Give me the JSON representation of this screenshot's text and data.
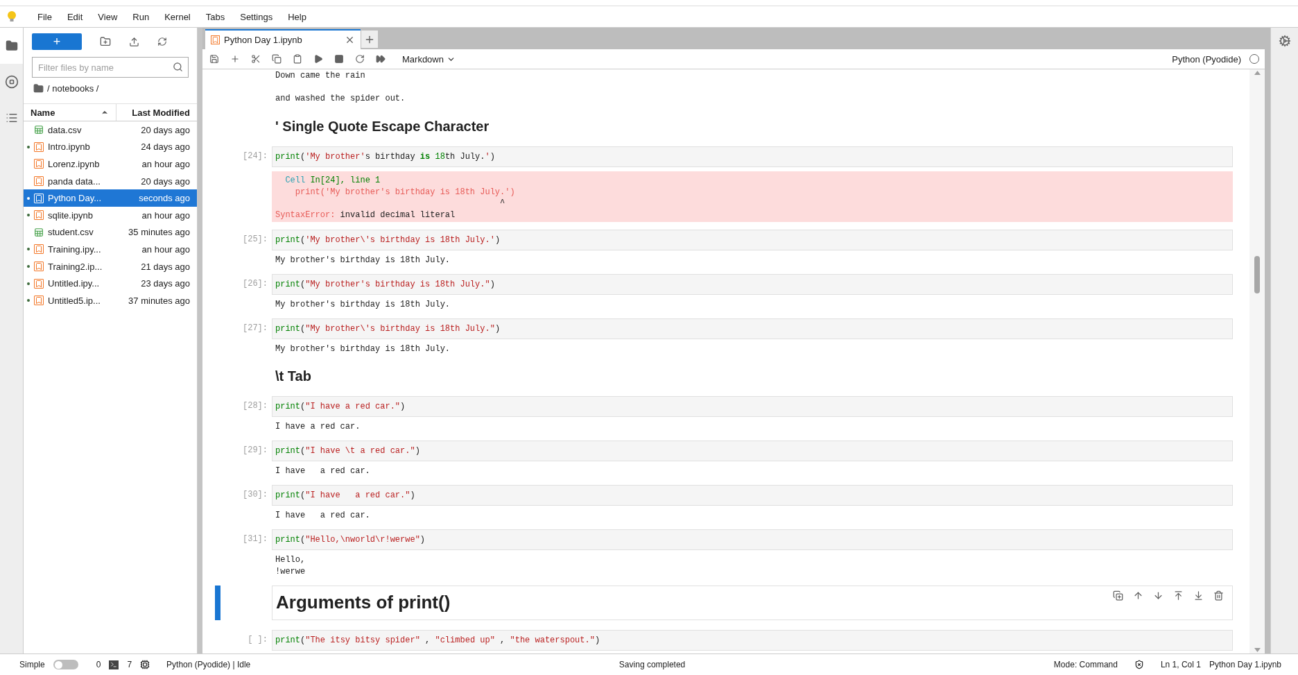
{
  "menu": [
    "File",
    "Edit",
    "View",
    "Run",
    "Kernel",
    "Tabs",
    "Settings",
    "Help"
  ],
  "left_rail": [
    {
      "kind": "folder",
      "selected": true
    },
    {
      "kind": "running",
      "selected": false
    },
    {
      "kind": "toc",
      "selected": false
    }
  ],
  "file_browser": {
    "new_button": "+",
    "filter": {
      "placeholder": "Filter files by name"
    },
    "path": "/ notebooks /",
    "columns": [
      {
        "label": "Name",
        "sorted": true
      },
      {
        "label": "Last Modified",
        "sorted": false
      }
    ],
    "files": [
      {
        "kind": "csv",
        "name": "data.csv",
        "modified": "20 days ago",
        "running": false,
        "selected": false
      },
      {
        "kind": "notebook",
        "name": "Intro.ipynb",
        "modified": "24 days ago",
        "running": true,
        "selected": false
      },
      {
        "kind": "notebook",
        "name": "Lorenz.ipynb",
        "modified": "an hour ago",
        "running": false,
        "selected": false
      },
      {
        "kind": "notebook",
        "name": "panda data...",
        "modified": "20 days ago",
        "running": false,
        "selected": false
      },
      {
        "kind": "notebook",
        "name": "Python Day...",
        "modified": "seconds ago",
        "running": true,
        "selected": true
      },
      {
        "kind": "notebook",
        "name": "sqlite.ipynb",
        "modified": "an hour ago",
        "running": true,
        "selected": false
      },
      {
        "kind": "csv",
        "name": "student.csv",
        "modified": "35 minutes ago",
        "running": false,
        "selected": false
      },
      {
        "kind": "notebook",
        "name": "Training.ipy...",
        "modified": "an hour ago",
        "running": true,
        "selected": false
      },
      {
        "kind": "notebook",
        "name": "Training2.ip...",
        "modified": "21 days ago",
        "running": true,
        "selected": false
      },
      {
        "kind": "notebook",
        "name": "Untitled.ipy...",
        "modified": "23 days ago",
        "running": true,
        "selected": false
      },
      {
        "kind": "notebook",
        "name": "Untitled5.ip...",
        "modified": "37 minutes ago",
        "running": true,
        "selected": false
      }
    ]
  },
  "tabs": [
    {
      "label": "Python Day 1.ipynb",
      "selected": true
    }
  ],
  "toolbar": {
    "cell_type": "Markdown",
    "kernel": "Python (Pyodide)",
    "kernel_busy": false
  },
  "cells": [
    {
      "kind": "text",
      "lines": [
        "Down came the rain",
        "and washed the spider out."
      ]
    },
    {
      "kind": "heading",
      "text": "' Single Quote Escape Character"
    },
    {
      "kind": "code",
      "prompt": "[24]:",
      "code": [
        {
          "kind": "builtin",
          "text": "print"
        },
        {
          "kind": "plain",
          "text": "("
        },
        {
          "kind": "string",
          "text": "'My brother'"
        },
        {
          "kind": "plain",
          "text": "s birthday "
        },
        {
          "kind": "keyword",
          "text": "is"
        },
        {
          "kind": "number",
          "text": " 18"
        },
        {
          "kind": "plain",
          "text": "th July."
        },
        {
          "kind": "string",
          "text": "'"
        },
        {
          "kind": "plain",
          "text": ")"
        }
      ],
      "error": [
        [
          {
            "kind": "cyan",
            "text": "  Cell"
          },
          {
            "kind": "green",
            "text": " In[24], line 1"
          }
        ],
        [
          {
            "kind": "red",
            "text": "    print('My brother's birthday is 18th July.')"
          }
        ],
        [
          {
            "kind": "plain",
            "text": "                                             ^"
          }
        ],
        [
          {
            "kind": "red",
            "text": "SyntaxError:"
          },
          {
            "kind": "plain",
            "text": " invalid decimal literal"
          }
        ]
      ]
    },
    {
      "kind": "code",
      "prompt": "[25]:",
      "code": [
        {
          "kind": "builtin",
          "text": "print"
        },
        {
          "kind": "plain",
          "text": "("
        },
        {
          "kind": "string",
          "text": "'My brother\\'s birthday is 18th July.'"
        },
        {
          "kind": "plain",
          "text": ")"
        }
      ],
      "output": [
        "My brother's birthday is 18th July."
      ]
    },
    {
      "kind": "code",
      "prompt": "[26]:",
      "code": [
        {
          "kind": "builtin",
          "text": "print"
        },
        {
          "kind": "plain",
          "text": "("
        },
        {
          "kind": "string",
          "text": "\"My brother's birthday is 18th July.\""
        },
        {
          "kind": "plain",
          "text": ")"
        }
      ],
      "output": [
        "My brother's birthday is 18th July."
      ]
    },
    {
      "kind": "code",
      "prompt": "[27]:",
      "code": [
        {
          "kind": "builtin",
          "text": "print"
        },
        {
          "kind": "plain",
          "text": "("
        },
        {
          "kind": "string",
          "text": "\"My brother\\'s birthday is 18th July.\""
        },
        {
          "kind": "plain",
          "text": ")"
        }
      ],
      "output": [
        "My brother's birthday is 18th July."
      ]
    },
    {
      "kind": "heading",
      "text": "\\t Tab"
    },
    {
      "kind": "code",
      "prompt": "[28]:",
      "code": [
        {
          "kind": "builtin",
          "text": "print"
        },
        {
          "kind": "plain",
          "text": "("
        },
        {
          "kind": "string",
          "text": "\"I have a red car.\""
        },
        {
          "kind": "plain",
          "text": ")"
        }
      ],
      "output": [
        "I have a red car."
      ]
    },
    {
      "kind": "code",
      "prompt": "[29]:",
      "code": [
        {
          "kind": "builtin",
          "text": "print"
        },
        {
          "kind": "plain",
          "text": "("
        },
        {
          "kind": "string",
          "text": "\"I have \\t a red car.\""
        },
        {
          "kind": "plain",
          "text": ")"
        }
      ],
      "output": [
        "I have   a red car."
      ]
    },
    {
      "kind": "code",
      "prompt": "[30]:",
      "code": [
        {
          "kind": "builtin",
          "text": "print"
        },
        {
          "kind": "plain",
          "text": "("
        },
        {
          "kind": "string",
          "text": "\"I have   a red car.\""
        },
        {
          "kind": "plain",
          "text": ")"
        }
      ],
      "output": [
        "I have   a red car."
      ]
    },
    {
      "kind": "code",
      "prompt": "[31]:",
      "code": [
        {
          "kind": "builtin",
          "text": "print"
        },
        {
          "kind": "plain",
          "text": "("
        },
        {
          "kind": "string",
          "text": "\"Hello,\\nworld\\r!werwe\""
        },
        {
          "kind": "plain",
          "text": ")"
        }
      ],
      "output": [
        "Hello,",
        "!werwe"
      ]
    },
    {
      "kind": "title",
      "text": "Arguments of print()",
      "active": true
    },
    {
      "kind": "code",
      "prompt": "[ ]:",
      "code": [
        {
          "kind": "builtin",
          "text": "print"
        },
        {
          "kind": "plain",
          "text": "("
        },
        {
          "kind": "string",
          "text": "\"The itsy bitsy spider\""
        },
        {
          "kind": "plain",
          "text": " , "
        },
        {
          "kind": "string",
          "text": "\"climbed up\""
        },
        {
          "kind": "plain",
          "text": " , "
        },
        {
          "kind": "string",
          "text": "\"the waterspout.\""
        },
        {
          "kind": "plain",
          "text": ")"
        }
      ]
    }
  ],
  "status_bar": {
    "simple_mode": {
      "label": "Simple",
      "on": false
    },
    "terminals": "0",
    "kernels": "7",
    "kernel_status": "Python (Pyodide) | Idle",
    "message": "Saving completed",
    "mode": "Mode: Command",
    "position": "Ln 1, Col 1",
    "file": "Python Day 1.ipynb"
  }
}
